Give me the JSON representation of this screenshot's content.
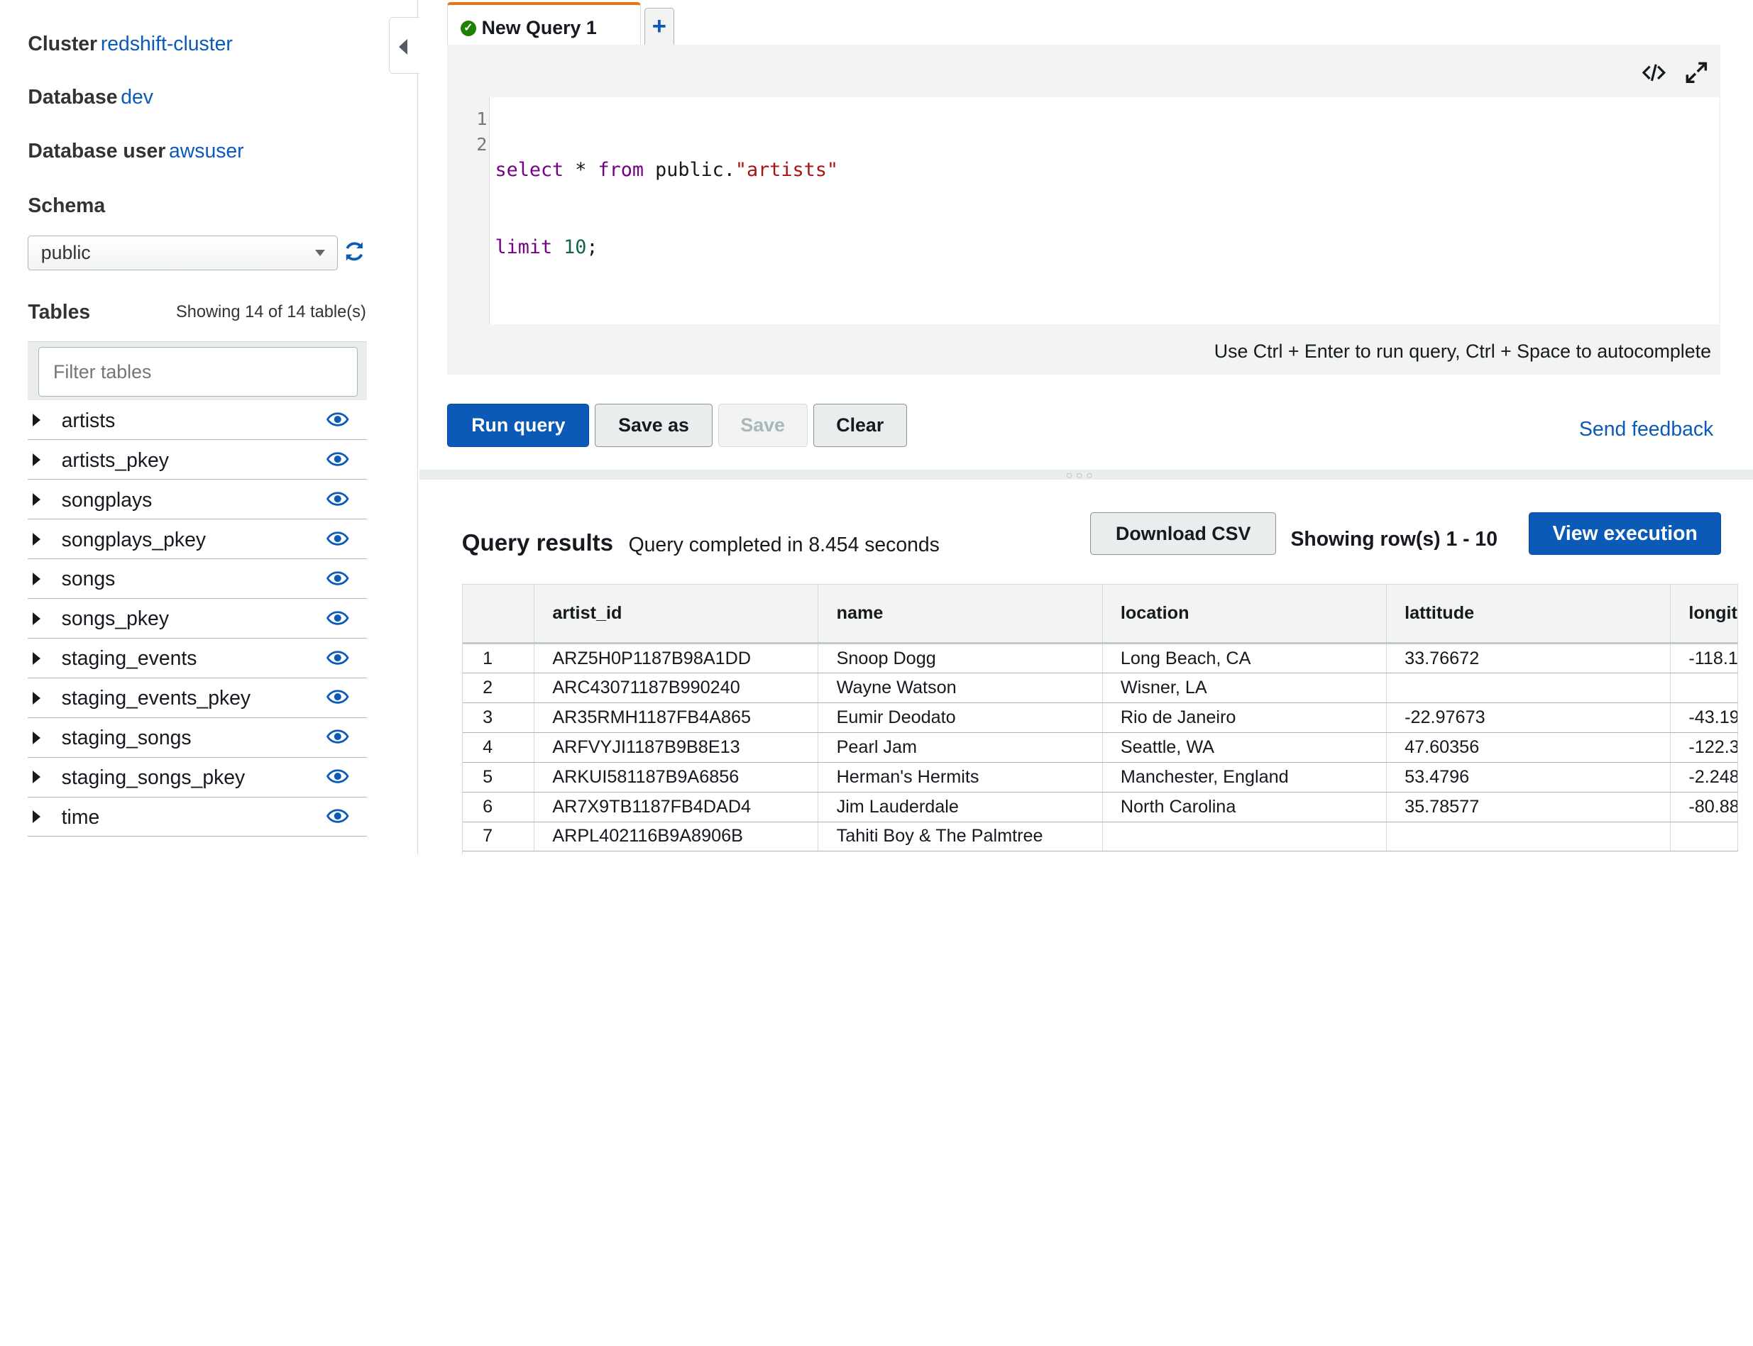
{
  "sidebar": {
    "cluster_label": "Cluster",
    "cluster_value": "redshift-cluster",
    "database_label": "Database",
    "database_value": "dev",
    "user_label": "Database user",
    "user_value": "awsuser",
    "schema_title": "Schema",
    "schema_selected": "public",
    "tables_title": "Tables",
    "tables_count": "Showing 14 of 14 table(s)",
    "filter_placeholder": "Filter tables",
    "tables": [
      "artists",
      "artists_pkey",
      "songplays",
      "songplays_pkey",
      "songs",
      "songs_pkey",
      "staging_events",
      "staging_events_pkey",
      "staging_songs",
      "staging_songs_pkey",
      "time"
    ]
  },
  "editor": {
    "tab_label": "New Query 1",
    "add_tab": "+",
    "line_numbers": [
      "1",
      "2"
    ],
    "code": {
      "l1_kw1": "select",
      "l1_star": " * ",
      "l1_kw2": "from",
      "l1_obj": " public.",
      "l1_str": "\"artists\"",
      "l2_kw": "limit",
      "l2_num": " 10",
      "l2_end": ";"
    },
    "hint": "Use Ctrl + Enter to run query, Ctrl + Space to autocomplete"
  },
  "actions": {
    "run": "Run query",
    "save_as": "Save as",
    "save": "Save",
    "clear": "Clear",
    "feedback": "Send feedback"
  },
  "results": {
    "title": "Query results",
    "status": "Query completed in 8.454 seconds",
    "download": "Download CSV",
    "rows_info": "Showing row(s) 1 - 10",
    "view_execution": "View execution",
    "columns": [
      "",
      "artist_id",
      "name",
      "location",
      "lattitude",
      "longit"
    ],
    "rows": [
      [
        "1",
        "ARZ5H0P1187B98A1DD",
        "Snoop Dogg",
        "Long Beach, CA",
        "33.76672",
        "-118.1"
      ],
      [
        "2",
        "ARC43071187B990240",
        "Wayne Watson",
        "Wisner, LA",
        "",
        ""
      ],
      [
        "3",
        "AR35RMH1187FB4A865",
        "Eumir Deodato",
        "Rio de Janeiro",
        "-22.97673",
        "-43.19"
      ],
      [
        "4",
        "ARFVYJI1187B9B8E13",
        "Pearl Jam",
        "Seattle, WA",
        "47.60356",
        "-122.3"
      ],
      [
        "5",
        "ARKUI581187B9A6856",
        "Herman's Hermits",
        "Manchester, England",
        "53.4796",
        "-2.248"
      ],
      [
        "6",
        "AR7X9TB1187FB4DAD4",
        "Jim Lauderdale",
        "North Carolina",
        "35.78577",
        "-80.88"
      ],
      [
        "7",
        "ARPL402116B9A8906B",
        "Tahiti Boy & The Palmtree",
        "",
        "",
        ""
      ]
    ]
  }
}
